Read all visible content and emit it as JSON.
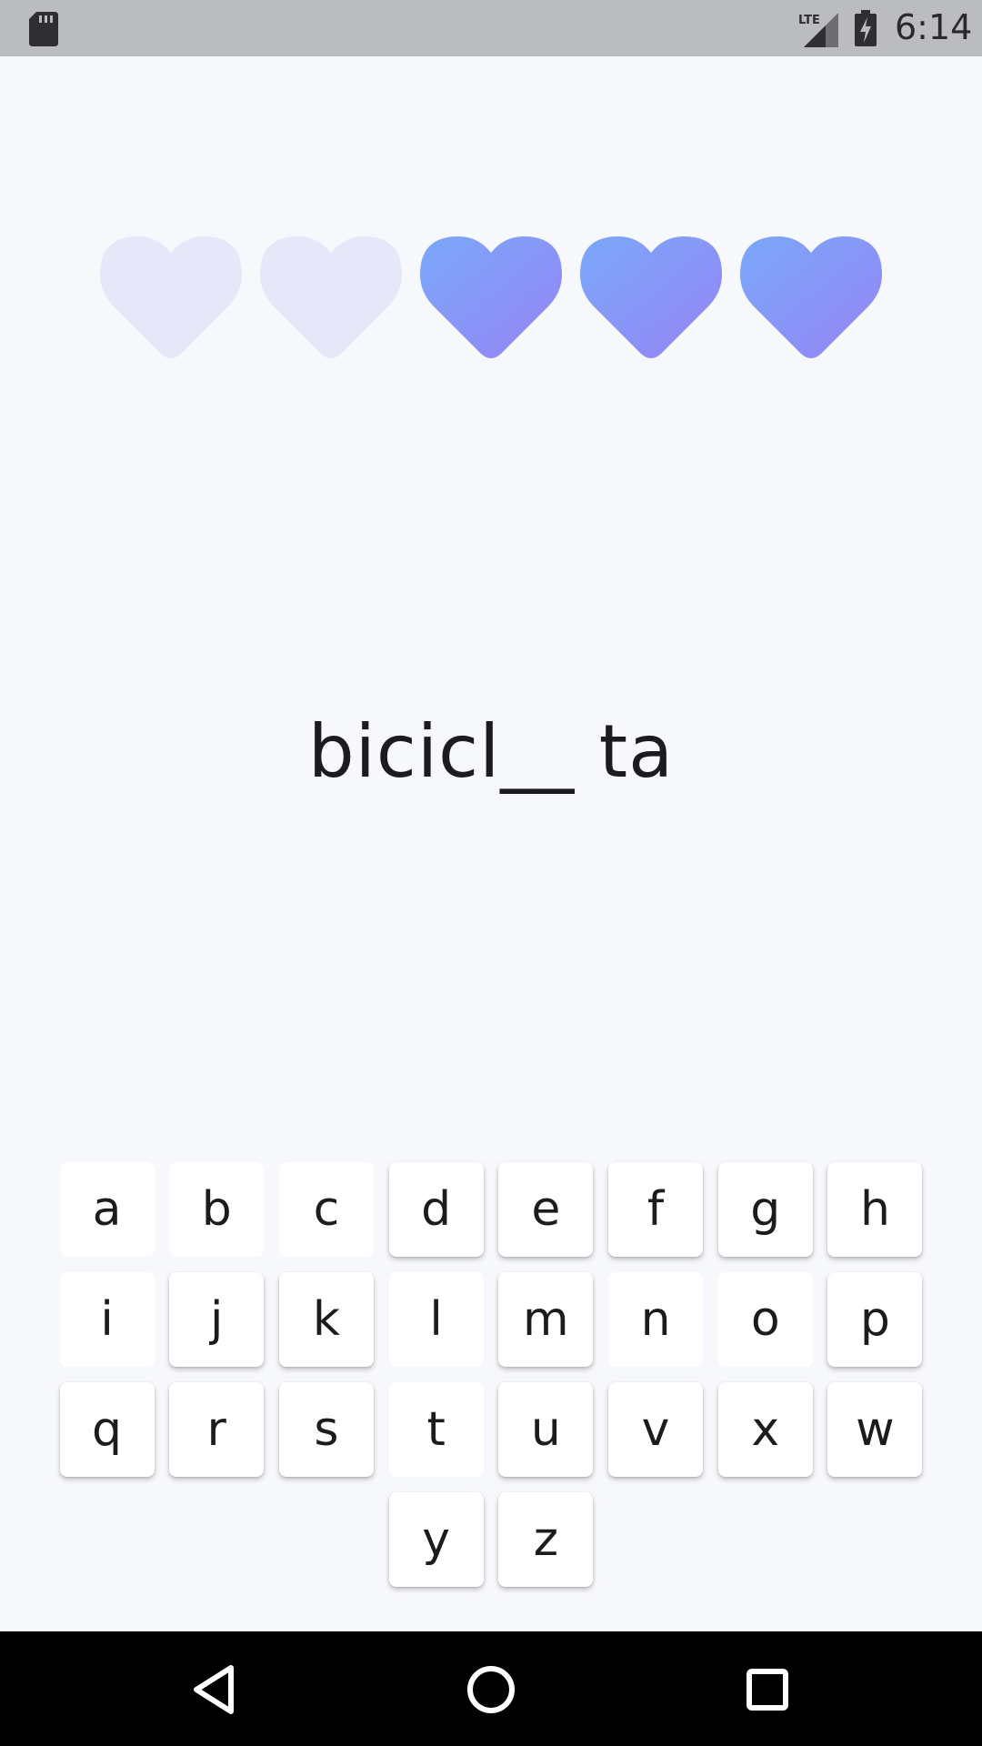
{
  "status_bar": {
    "time": "6:14",
    "network_label": "LTE",
    "icons": [
      "sd-card-icon",
      "lte-signal-icon",
      "battery-charging-icon"
    ]
  },
  "game": {
    "lives": {
      "total": 5,
      "remaining": 3,
      "lost": 2
    },
    "puzzle_word": "bicicl__ ta",
    "colors": {
      "heart_full_start": "#7aa8fa",
      "heart_full_end": "#9684f5",
      "heart_empty": "#e6e8fa",
      "background": "#f7f8fc"
    }
  },
  "keyboard": {
    "rows": [
      [
        {
          "letter": "a",
          "used": true
        },
        {
          "letter": "b",
          "used": true
        },
        {
          "letter": "c",
          "used": true
        },
        {
          "letter": "d",
          "used": false
        },
        {
          "letter": "e",
          "used": false
        },
        {
          "letter": "f",
          "used": false
        },
        {
          "letter": "g",
          "used": false
        },
        {
          "letter": "h",
          "used": false
        }
      ],
      [
        {
          "letter": "i",
          "used": true
        },
        {
          "letter": "j",
          "used": false
        },
        {
          "letter": "k",
          "used": false
        },
        {
          "letter": "l",
          "used": true
        },
        {
          "letter": "m",
          "used": false
        },
        {
          "letter": "n",
          "used": true
        },
        {
          "letter": "o",
          "used": true
        },
        {
          "letter": "p",
          "used": false
        }
      ],
      [
        {
          "letter": "q",
          "used": false
        },
        {
          "letter": "r",
          "used": false
        },
        {
          "letter": "s",
          "used": false
        },
        {
          "letter": "t",
          "used": true
        },
        {
          "letter": "u",
          "used": false
        },
        {
          "letter": "v",
          "used": false
        },
        {
          "letter": "x",
          "used": false
        },
        {
          "letter": "w",
          "used": false
        }
      ],
      [
        {
          "letter": "y",
          "used": false
        },
        {
          "letter": "z",
          "used": false
        }
      ]
    ]
  },
  "navigation": {
    "buttons": [
      "back-icon",
      "home-icon",
      "recents-icon"
    ]
  }
}
